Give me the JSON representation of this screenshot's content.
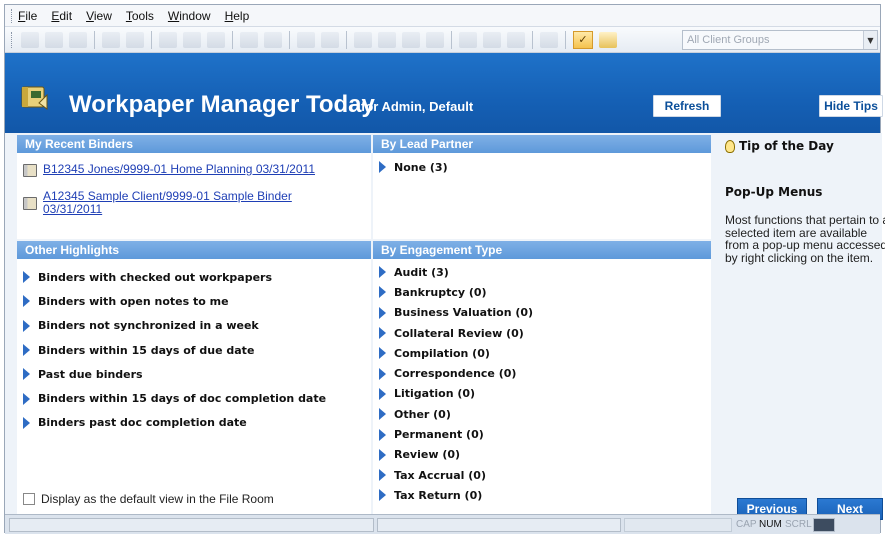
{
  "menu": [
    "File",
    "Edit",
    "View",
    "Tools",
    "Window",
    "Help"
  ],
  "toolbar": {
    "client_group_select": "All Client Groups",
    "icons": [
      "new-icon",
      "open-icon",
      "print-icon",
      "cut-icon",
      "copy-icon",
      "paste-icon",
      "workpaper-icon",
      "binder-icon",
      "sync-icon",
      "settings-icon",
      "checkin-icon",
      "active-binder-icon",
      "notes-icon"
    ]
  },
  "header": {
    "title": "Workpaper Manager Today",
    "subtitle": "for Admin, Default",
    "refresh_label": "Refresh",
    "hide_tips_label": "Hide Tips"
  },
  "recent_binders": {
    "title": "My Recent Binders",
    "items": [
      "B12345 Jones/9999-01 Home Planning 03/31/2011",
      "A12345 Sample Client/9999-01 Sample Binder 03/31/2011"
    ]
  },
  "lead_partner": {
    "title": "By Lead Partner",
    "items": [
      "None (3)"
    ]
  },
  "other_highlights": {
    "title": "Other Highlights",
    "items": [
      "Binders with checked out workpapers",
      "Binders with open notes to me",
      "Binders not synchronized in a week",
      "Binders within 15 days of due date",
      "Past due binders",
      "Binders within 15 days of doc completion date",
      "Binders past doc completion date"
    ],
    "default_view_label": "Display as the default view in the File Room"
  },
  "engagement_type": {
    "title": "By Engagement Type",
    "items": [
      "Audit (3)",
      "Bankruptcy (0)",
      "Business Valuation (0)",
      "Collateral Review (0)",
      "Compilation (0)",
      "Correspondence (0)",
      "Litigation (0)",
      "Other (0)",
      "Permanent (0)",
      "Review (0)",
      "Tax Accrual (0)",
      "Tax Return (0)"
    ]
  },
  "tip": {
    "title": "Tip of the Day",
    "heading": "Pop-Up Menus",
    "text": "Most functions that pertain to a selected item are available from a pop-up menu accessed by right clicking on the item.",
    "previous_label": "Previous",
    "next_label": "Next"
  },
  "statusbar": {
    "cap": "CAP",
    "num": "NUM",
    "scrl": "SCRL"
  },
  "colors": {
    "banner": "#1560b5",
    "panel_header": "#6ea3df",
    "link": "#1f3fb5"
  }
}
